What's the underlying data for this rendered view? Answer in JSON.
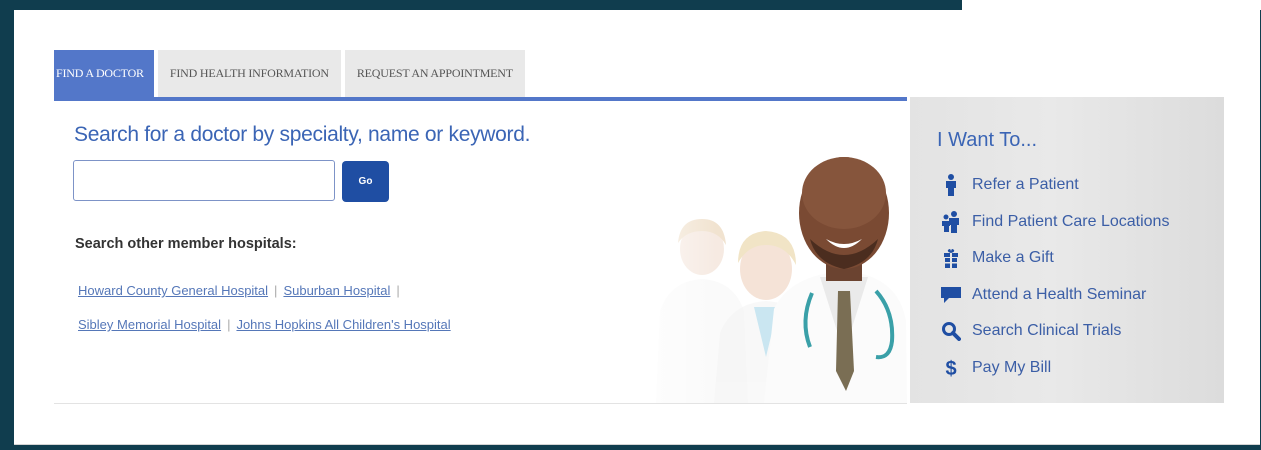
{
  "tabs": [
    {
      "label": "FIND A DOCTOR",
      "active": true
    },
    {
      "label": "FIND HEALTH INFORMATION",
      "active": false
    },
    {
      "label": "REQUEST AN APPOINTMENT",
      "active": false
    }
  ],
  "search": {
    "heading": "Search for a doctor by specialty, name or keyword.",
    "input_value": "",
    "go_label": "Go"
  },
  "member_hospitals": {
    "label": "Search other member hospitals:",
    "separator": "|",
    "links": [
      "Howard County General Hospital",
      "Suburban Hospital",
      "Sibley Memorial Hospital",
      "Johns Hopkins All Children's Hospital"
    ]
  },
  "sidebar": {
    "title": "I Want To...",
    "items": [
      {
        "label": "Refer a Patient",
        "icon": "person-icon"
      },
      {
        "label": "Find Patient Care Locations",
        "icon": "people-icon"
      },
      {
        "label": "Make a Gift",
        "icon": "gift-icon"
      },
      {
        "label": "Attend a Health Seminar",
        "icon": "speech-bubble-icon"
      },
      {
        "label": "Search Clinical Trials",
        "icon": "magnifier-icon"
      },
      {
        "label": "Pay My Bill",
        "icon": "dollar-icon"
      }
    ]
  },
  "colors": {
    "accent_blue": "#5377c9",
    "link_blue": "#5577b8",
    "go_button": "#1f4ea3",
    "frame_dark": "#103d4e"
  }
}
